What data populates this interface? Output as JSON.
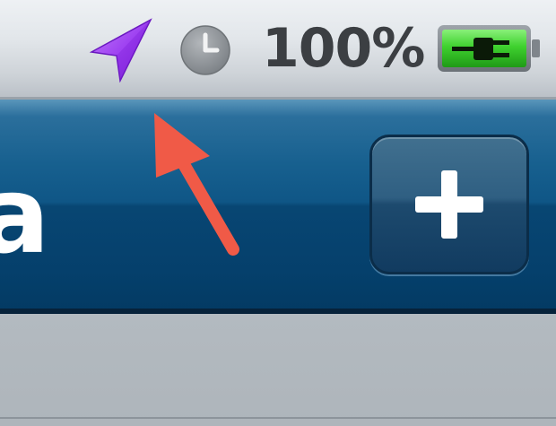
{
  "status_bar": {
    "battery_percent": "100%",
    "battery_level": 1.0,
    "icons": [
      "location-services-arrow-icon",
      "alarm-clock-icon",
      "battery-charging-icon"
    ],
    "location_icon_color": "#9b3cf0",
    "battery_fill_color": "#3fd12f"
  },
  "nav_bar": {
    "title_fragment": "a",
    "add_button_icon": "plus-icon",
    "bar_color": "#0f5686"
  },
  "annotation": {
    "type": "arrow",
    "color": "#f05a47"
  }
}
